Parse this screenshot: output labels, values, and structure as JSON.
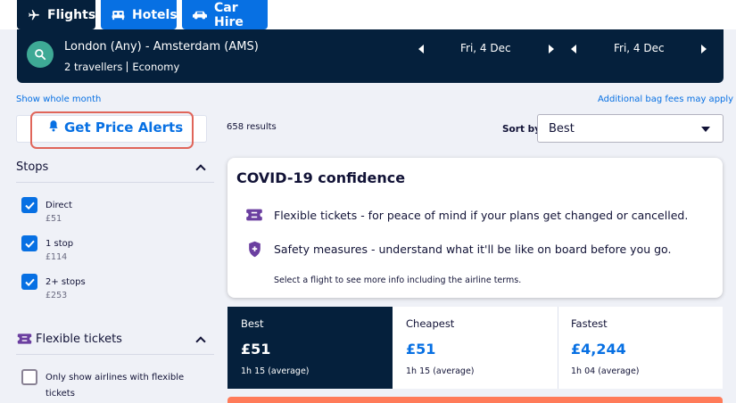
{
  "tabs": [
    {
      "label": "Flights",
      "icon": "plane-icon",
      "active": true
    },
    {
      "label": "Hotels",
      "icon": "bed-icon",
      "active": false
    },
    {
      "label": "Car Hire",
      "icon": "car-icon",
      "active": false
    }
  ],
  "search": {
    "route": "London (Any) - Amsterdam (AMS)",
    "travellers": "2 travellers",
    "cabin": "Economy",
    "depart_date": "Fri, 4 Dec",
    "return_date": "Fri, 4 Dec"
  },
  "links": {
    "show_whole_month": "Show whole month",
    "bag_fees": "Additional bag fees may apply"
  },
  "price_alerts": {
    "label": "Get Price Alerts"
  },
  "filters": {
    "stops": {
      "title": "Stops",
      "options": [
        {
          "label": "Direct",
          "price": "£51",
          "checked": true
        },
        {
          "label": "1 stop",
          "price": "£114",
          "checked": true
        },
        {
          "label": "2+ stops",
          "price": "£253",
          "checked": true
        }
      ]
    },
    "flexible": {
      "title": "Flexible tickets",
      "option_line1": "Only show airlines with flexible",
      "option_line2": "tickets",
      "checked": false
    }
  },
  "results": {
    "count": "658 results",
    "sort_label": "Sort by",
    "sort_value": "Best"
  },
  "covid": {
    "title": "COVID-19 confidence",
    "row1": "Flexible tickets - for peace of mind if your plans get changed or cancelled.",
    "row2": "Safety measures - understand what it'll be like on board before you go.",
    "note": "Select a flight to see more info including the airline terms."
  },
  "sort_cards": [
    {
      "title": "Best",
      "price": "£51",
      "duration": "1h 15 (average)"
    },
    {
      "title": "Cheapest",
      "price": "£51",
      "duration": "1h 15 (average)"
    },
    {
      "title": "Fastest",
      "price": "£4,244",
      "duration": "1h 04 (average)"
    }
  ],
  "colors": {
    "navy": "#05203c",
    "blue": "#0770e3",
    "highlight": "#e0655a",
    "teal": "#3ea995",
    "orange": "#ff7b59"
  }
}
